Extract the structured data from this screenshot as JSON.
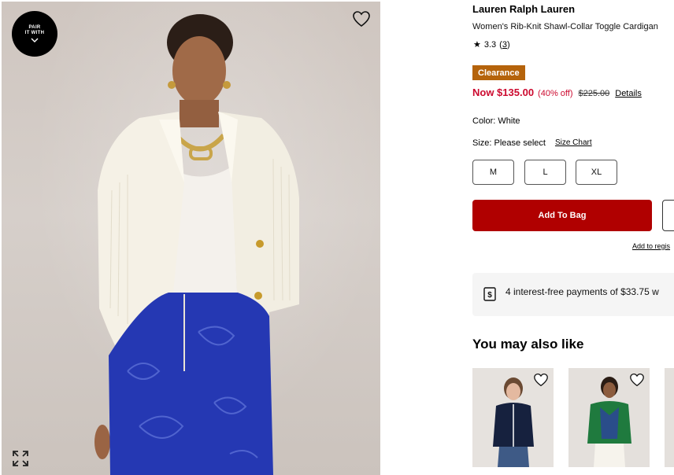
{
  "hero": {
    "pair_badge": {
      "line1": "PAIR",
      "line2": "IT WITH"
    }
  },
  "product": {
    "brand": "Lauren Ralph Lauren",
    "name": "Women's Rib-Knit Shawl-Collar Toggle Cardigan",
    "rating": "3.3",
    "review_count": "3",
    "badge": "Clearance",
    "price_now": "Now $135.00",
    "price_off": "(40% off)",
    "price_was": "$225.00",
    "details_label": "Details",
    "color_label": "Color: White",
    "size_label": "Size: Please select",
    "size_chart_label": "Size Chart",
    "sizes": [
      "M",
      "L",
      "XL"
    ],
    "add_to_bag": "Add To Bag",
    "add_to_registry": "Add to regis"
  },
  "payment": {
    "text": "4 interest-free payments of $33.75 w"
  },
  "recommendations": {
    "title": "You may also like"
  },
  "colors": {
    "sale_red": "#cc0a2f",
    "bag_red": "#b00000",
    "clearance": "#b5630b"
  }
}
